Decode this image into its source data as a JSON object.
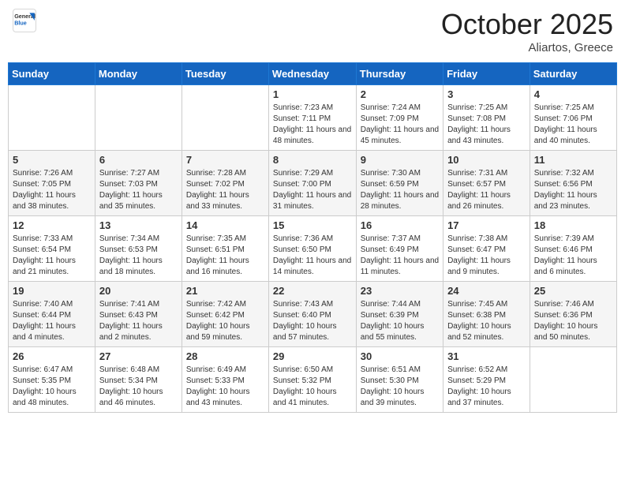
{
  "header": {
    "logo_general": "General",
    "logo_blue": "Blue",
    "month_title": "October 2025",
    "subtitle": "Aliartos, Greece"
  },
  "weekdays": [
    "Sunday",
    "Monday",
    "Tuesday",
    "Wednesday",
    "Thursday",
    "Friday",
    "Saturday"
  ],
  "weeks": [
    [
      {
        "day": "",
        "info": ""
      },
      {
        "day": "",
        "info": ""
      },
      {
        "day": "",
        "info": ""
      },
      {
        "day": "1",
        "info": "Sunrise: 7:23 AM\nSunset: 7:11 PM\nDaylight: 11 hours and 48 minutes."
      },
      {
        "day": "2",
        "info": "Sunrise: 7:24 AM\nSunset: 7:09 PM\nDaylight: 11 hours and 45 minutes."
      },
      {
        "day": "3",
        "info": "Sunrise: 7:25 AM\nSunset: 7:08 PM\nDaylight: 11 hours and 43 minutes."
      },
      {
        "day": "4",
        "info": "Sunrise: 7:25 AM\nSunset: 7:06 PM\nDaylight: 11 hours and 40 minutes."
      }
    ],
    [
      {
        "day": "5",
        "info": "Sunrise: 7:26 AM\nSunset: 7:05 PM\nDaylight: 11 hours and 38 minutes."
      },
      {
        "day": "6",
        "info": "Sunrise: 7:27 AM\nSunset: 7:03 PM\nDaylight: 11 hours and 35 minutes."
      },
      {
        "day": "7",
        "info": "Sunrise: 7:28 AM\nSunset: 7:02 PM\nDaylight: 11 hours and 33 minutes."
      },
      {
        "day": "8",
        "info": "Sunrise: 7:29 AM\nSunset: 7:00 PM\nDaylight: 11 hours and 31 minutes."
      },
      {
        "day": "9",
        "info": "Sunrise: 7:30 AM\nSunset: 6:59 PM\nDaylight: 11 hours and 28 minutes."
      },
      {
        "day": "10",
        "info": "Sunrise: 7:31 AM\nSunset: 6:57 PM\nDaylight: 11 hours and 26 minutes."
      },
      {
        "day": "11",
        "info": "Sunrise: 7:32 AM\nSunset: 6:56 PM\nDaylight: 11 hours and 23 minutes."
      }
    ],
    [
      {
        "day": "12",
        "info": "Sunrise: 7:33 AM\nSunset: 6:54 PM\nDaylight: 11 hours and 21 minutes."
      },
      {
        "day": "13",
        "info": "Sunrise: 7:34 AM\nSunset: 6:53 PM\nDaylight: 11 hours and 18 minutes."
      },
      {
        "day": "14",
        "info": "Sunrise: 7:35 AM\nSunset: 6:51 PM\nDaylight: 11 hours and 16 minutes."
      },
      {
        "day": "15",
        "info": "Sunrise: 7:36 AM\nSunset: 6:50 PM\nDaylight: 11 hours and 14 minutes."
      },
      {
        "day": "16",
        "info": "Sunrise: 7:37 AM\nSunset: 6:49 PM\nDaylight: 11 hours and 11 minutes."
      },
      {
        "day": "17",
        "info": "Sunrise: 7:38 AM\nSunset: 6:47 PM\nDaylight: 11 hours and 9 minutes."
      },
      {
        "day": "18",
        "info": "Sunrise: 7:39 AM\nSunset: 6:46 PM\nDaylight: 11 hours and 6 minutes."
      }
    ],
    [
      {
        "day": "19",
        "info": "Sunrise: 7:40 AM\nSunset: 6:44 PM\nDaylight: 11 hours and 4 minutes."
      },
      {
        "day": "20",
        "info": "Sunrise: 7:41 AM\nSunset: 6:43 PM\nDaylight: 11 hours and 2 minutes."
      },
      {
        "day": "21",
        "info": "Sunrise: 7:42 AM\nSunset: 6:42 PM\nDaylight: 10 hours and 59 minutes."
      },
      {
        "day": "22",
        "info": "Sunrise: 7:43 AM\nSunset: 6:40 PM\nDaylight: 10 hours and 57 minutes."
      },
      {
        "day": "23",
        "info": "Sunrise: 7:44 AM\nSunset: 6:39 PM\nDaylight: 10 hours and 55 minutes."
      },
      {
        "day": "24",
        "info": "Sunrise: 7:45 AM\nSunset: 6:38 PM\nDaylight: 10 hours and 52 minutes."
      },
      {
        "day": "25",
        "info": "Sunrise: 7:46 AM\nSunset: 6:36 PM\nDaylight: 10 hours and 50 minutes."
      }
    ],
    [
      {
        "day": "26",
        "info": "Sunrise: 6:47 AM\nSunset: 5:35 PM\nDaylight: 10 hours and 48 minutes."
      },
      {
        "day": "27",
        "info": "Sunrise: 6:48 AM\nSunset: 5:34 PM\nDaylight: 10 hours and 46 minutes."
      },
      {
        "day": "28",
        "info": "Sunrise: 6:49 AM\nSunset: 5:33 PM\nDaylight: 10 hours and 43 minutes."
      },
      {
        "day": "29",
        "info": "Sunrise: 6:50 AM\nSunset: 5:32 PM\nDaylight: 10 hours and 41 minutes."
      },
      {
        "day": "30",
        "info": "Sunrise: 6:51 AM\nSunset: 5:30 PM\nDaylight: 10 hours and 39 minutes."
      },
      {
        "day": "31",
        "info": "Sunrise: 6:52 AM\nSunset: 5:29 PM\nDaylight: 10 hours and 37 minutes."
      },
      {
        "day": "",
        "info": ""
      }
    ]
  ]
}
